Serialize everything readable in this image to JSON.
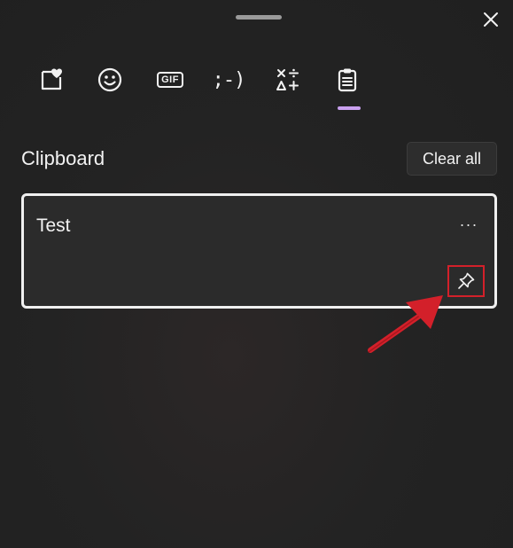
{
  "window": {
    "close_icon": "close-icon"
  },
  "tabs": [
    {
      "name": "recent-heart",
      "icon": "heart-note-icon"
    },
    {
      "name": "emoji",
      "icon": "smiley-icon"
    },
    {
      "name": "gif",
      "icon": "gif-icon",
      "text": "GIF"
    },
    {
      "name": "kaomoji",
      "icon": "kaomoji-icon",
      "text": ";-)"
    },
    {
      "name": "symbols",
      "icon": "symbols-icon"
    },
    {
      "name": "clipboard",
      "icon": "clipboard-icon",
      "selected": true
    }
  ],
  "accent_color": "#c9a0ef",
  "clipboard": {
    "title": "Clipboard",
    "clear_all_label": "Clear all",
    "items": [
      {
        "text": "Test",
        "more_label": "···",
        "pin_icon": "pin-icon"
      }
    ]
  },
  "annotation": {
    "highlight_color": "#d3202a",
    "arrow_icon": "red-arrow-annotation"
  }
}
